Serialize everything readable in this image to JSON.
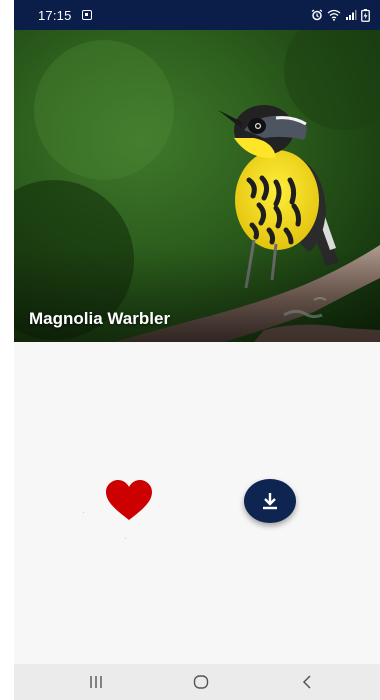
{
  "status_bar": {
    "time": "17:15",
    "background": "#0b1d49"
  },
  "hero": {
    "title": "Magnolia Warbler"
  },
  "actions": {
    "favorite_icon": "heart-icon",
    "favorite_color": "#cc0000",
    "download_icon": "download-icon",
    "download_color": "#0e2552"
  },
  "nav_bar": {
    "recents_icon": "recents-icon",
    "home_icon": "home-icon",
    "back_icon": "back-icon"
  }
}
